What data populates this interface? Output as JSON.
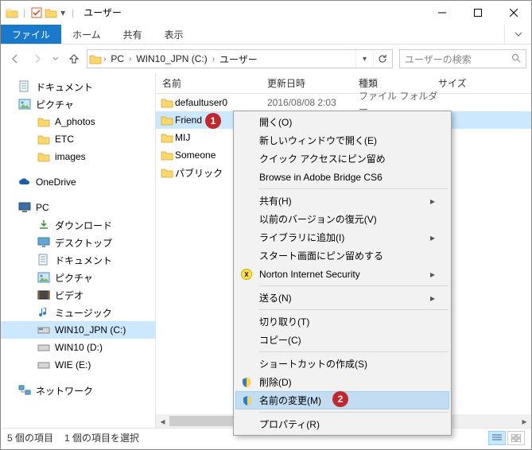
{
  "window": {
    "title": "ユーザー"
  },
  "ribbon": {
    "file": "ファイル",
    "tabs": [
      "ホーム",
      "共有",
      "表示"
    ]
  },
  "address": {
    "segments": [
      "PC",
      "WIN10_JPN (C:)",
      "ユーザー"
    ]
  },
  "search": {
    "placeholder": "ユーザーの検索"
  },
  "tree": {
    "group1": [
      {
        "icon": "documents",
        "label": "ドキュメント"
      },
      {
        "icon": "pictures",
        "label": "ピクチャ"
      }
    ],
    "group1_children": [
      {
        "label": "A_photos"
      },
      {
        "label": "ETC"
      },
      {
        "label": "images"
      }
    ],
    "onedrive": "OneDrive",
    "pc": "PC",
    "pc_children": [
      {
        "icon": "downloads",
        "label": "ダウンロード"
      },
      {
        "icon": "desktop",
        "label": "デスクトップ"
      },
      {
        "icon": "documents",
        "label": "ドキュメント"
      },
      {
        "icon": "pictures",
        "label": "ピクチャ"
      },
      {
        "icon": "videos",
        "label": "ビデオ"
      },
      {
        "icon": "music",
        "label": "ミュージック"
      },
      {
        "icon": "drive",
        "label": "WIN10_JPN (C:)",
        "selected": true
      },
      {
        "icon": "drive",
        "label": "WIN10 (D:)"
      },
      {
        "icon": "drive",
        "label": "WIE (E:)"
      }
    ],
    "network": "ネットワーク"
  },
  "columns": {
    "name": "名前",
    "date": "更新日時",
    "type": "種類",
    "size": "サイズ"
  },
  "files": [
    {
      "name": "defaultuser0",
      "date": "2016/08/08 2:03",
      "type": "ファイル フォルダー"
    },
    {
      "name": "Friend",
      "date": "",
      "type": "",
      "selected": true
    },
    {
      "name": "MIJ",
      "date": "",
      "type": ""
    },
    {
      "name": "Someone",
      "date": "",
      "type": ""
    },
    {
      "name": "パブリック",
      "date": "",
      "type": ""
    }
  ],
  "context_menu": {
    "groups": [
      [
        {
          "label": "開く(O)"
        },
        {
          "label": "新しいウィンドウで開く(E)"
        },
        {
          "label": "クイック アクセスにピン留め"
        },
        {
          "label": "Browse in Adobe Bridge CS6"
        }
      ],
      [
        {
          "label": "共有(H)",
          "submenu": true
        },
        {
          "label": "以前のバージョンの復元(V)"
        },
        {
          "label": "ライブラリに追加(I)",
          "submenu": true
        },
        {
          "label": "スタート画面にピン留めする"
        },
        {
          "label": "Norton Internet Security",
          "icon": "norton",
          "submenu": true
        }
      ],
      [
        {
          "label": "送る(N)",
          "submenu": true
        }
      ],
      [
        {
          "label": "切り取り(T)"
        },
        {
          "label": "コピー(C)"
        }
      ],
      [
        {
          "label": "ショートカットの作成(S)"
        },
        {
          "label": "削除(D)",
          "icon": "shield"
        },
        {
          "label": "名前の変更(M)",
          "icon": "shield",
          "hover": true
        }
      ],
      [
        {
          "label": "プロパティ(R)"
        }
      ]
    ]
  },
  "status": {
    "count": "5 個の項目",
    "selected": "1 個の項目を選択"
  },
  "markers": {
    "m1": "1",
    "m2": "2"
  }
}
